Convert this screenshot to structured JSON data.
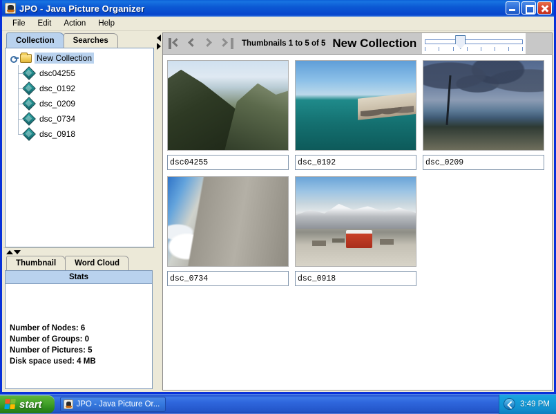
{
  "window": {
    "title": "JPO - Java Picture Organizer",
    "icon": "java-cup-icon",
    "buttons": {
      "minimize": "minimize-button",
      "maximize": "maximize-button",
      "close": "close-button"
    }
  },
  "menubar": {
    "items": [
      {
        "label": "File"
      },
      {
        "label": "Edit"
      },
      {
        "label": "Action"
      },
      {
        "label": "Help"
      }
    ]
  },
  "left_panel": {
    "tabs": [
      {
        "label": "Collection",
        "active": true
      },
      {
        "label": "Searches",
        "active": false
      }
    ],
    "tree": {
      "root": {
        "label": "New Collection",
        "icon": "folder-icon",
        "selected": true
      },
      "children": [
        {
          "label": "dsc04255",
          "icon": "picture-node-icon"
        },
        {
          "label": "dsc_0192",
          "icon": "picture-node-icon"
        },
        {
          "label": "dsc_0209",
          "icon": "picture-node-icon"
        },
        {
          "label": "dsc_0734",
          "icon": "picture-node-icon"
        },
        {
          "label": "dsc_0918",
          "icon": "picture-node-icon"
        }
      ]
    },
    "splitter": {
      "up": "collapse-up-arrow",
      "down": "collapse-down-arrow"
    },
    "info_tabs": [
      {
        "label": "Thumbnail",
        "active": false
      },
      {
        "label": "Word Cloud",
        "active": false
      }
    ],
    "stats": {
      "header": "Stats",
      "lines": [
        "Number of Nodes: 6",
        "Number of Groups: 0",
        "Number of Pictures: 5",
        "Disk space used: 4 MB"
      ]
    }
  },
  "vertical_splitter": {
    "left": "collapse-left-arrow",
    "right": "collapse-right-arrow"
  },
  "toolbar": {
    "nav": [
      {
        "name": "first-button",
        "glyph": "first",
        "enabled": true
      },
      {
        "name": "previous-button",
        "glyph": "previous",
        "enabled": true
      },
      {
        "name": "next-button",
        "glyph": "next",
        "enabled": false
      },
      {
        "name": "last-button",
        "glyph": "last",
        "enabled": false
      }
    ],
    "count_text": "Thumbnails 1 to 5 of 5",
    "collection_title": "New Collection",
    "size_slider": {
      "name": "thumbnail-size-slider",
      "ticks": 8,
      "thumb_position_percent": 34
    }
  },
  "thumbnails": [
    {
      "label": "dsc04255",
      "photo": "mountain-valley",
      "style": "ph-valley"
    },
    {
      "label": "dsc_0192",
      "photo": "bridge-over-ocean",
      "style": "ph-bridge"
    },
    {
      "label": "dsc_0209",
      "photo": "dusk-palm-beach",
      "style": "ph-palm"
    },
    {
      "label": "dsc_0734",
      "photo": "rocky-alpine-slope",
      "style": "ph-rock"
    },
    {
      "label": "dsc_0918",
      "photo": "red-mountain-train",
      "style": "ph-train"
    }
  ],
  "taskbar": {
    "start_label": "start",
    "items": [
      {
        "label": "JPO - Java Picture Or...",
        "icon": "java-cup-icon"
      }
    ],
    "tray": {
      "toggle": "show-hidden-icons-button",
      "clock": "3:49 PM"
    }
  },
  "colors": {
    "title_blue": "#0c5ad4",
    "selection_blue": "#b9d2ee",
    "panel_beige": "#ece9d8",
    "toolbar_gray": "#c8c8c8",
    "taskbar_blue": "#2f67dd",
    "start_green": "#43a32a"
  }
}
